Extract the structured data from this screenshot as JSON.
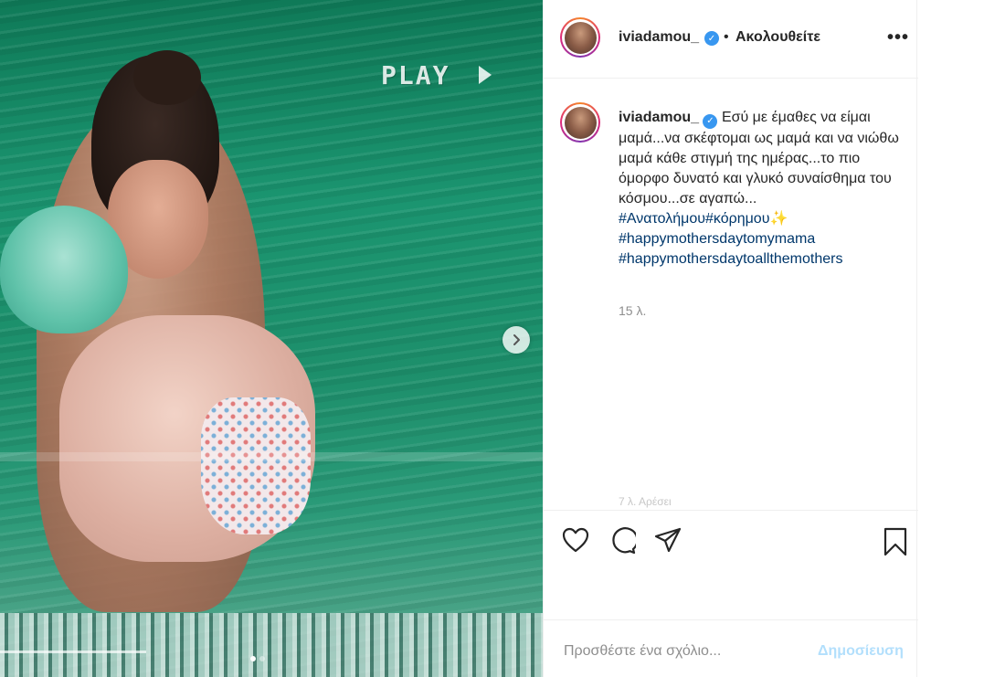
{
  "media": {
    "overlay_text": "PLAY",
    "carousel": {
      "active_index": 0,
      "total": 2
    }
  },
  "post": {
    "username": "iviadamou_",
    "separator": "•",
    "follow_label": "Ακολουθείτε",
    "more_label": "•••",
    "caption_text": "Εσύ με έμαθες να είμαι μαμά...να σκέφτομαι ως μαμά και να νιώθω μαμά κάθε στιγμή της ημέρας...το πιο όμορφο δυνατό και γλυκό συναίσθημα του κόσμου...σε αγαπώ...",
    "hashtags": [
      "#Ανατολήμου#κόρημου",
      "#happymothersdaytomymama",
      "#happymothersdaytoallthemothers"
    ],
    "time_ago": "15 λ.",
    "faded_line": "7 λ. Αρέσει"
  },
  "comment": {
    "placeholder": "Προσθέστε ένα σχόλιο...",
    "post_label": "Δημοσίευση"
  },
  "colors": {
    "verified": "#3897f0",
    "hashtag": "#00376b",
    "post_button_disabled": "#b2dffc"
  },
  "icons": [
    "verified-badge-icon",
    "more-options-icon",
    "next-arrow-icon",
    "heart-icon",
    "comment-icon",
    "share-icon",
    "bookmark-icon",
    "sparkle-icon"
  ]
}
